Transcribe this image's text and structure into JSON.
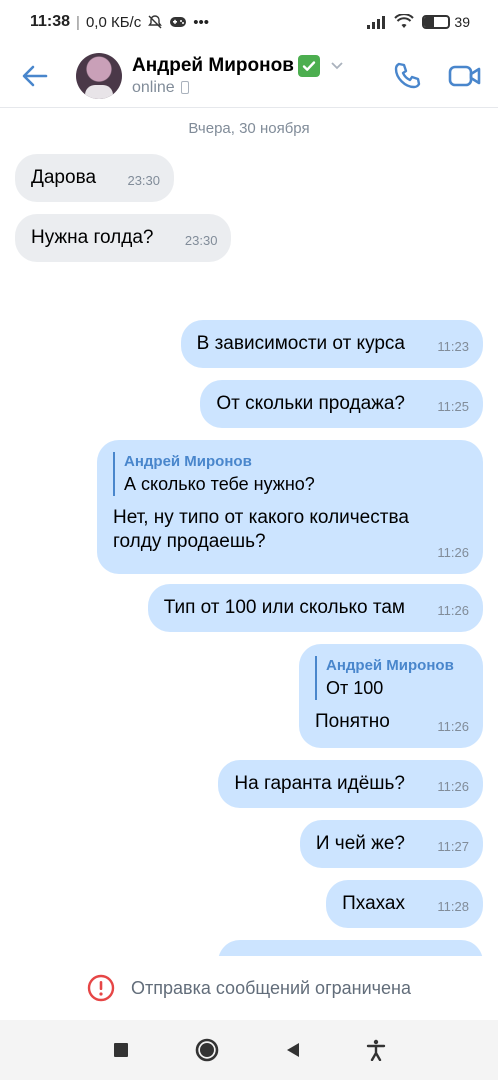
{
  "status_bar": {
    "time": "11:38",
    "network_speed": "0,0 КБ/с",
    "more": "•••",
    "battery_percent": "39",
    "battery_level": 0.39
  },
  "header": {
    "contact_name": "Андрей Миронов",
    "status": "online",
    "accent_color": "#4986cc"
  },
  "date_separator": "Вчера, 30 ноября",
  "messages": [
    {
      "direction": "in",
      "text": "Дарова",
      "time": "23:30"
    },
    {
      "direction": "in",
      "text": "Нужна голда?",
      "time": "23:30"
    },
    {
      "direction": "out",
      "text": "В зависимости от курса",
      "time": "11:23"
    },
    {
      "direction": "out",
      "text": "От скольки продажа?",
      "time": "11:25"
    },
    {
      "direction": "out",
      "reply_author": "Андрей Миронов",
      "reply_text": "А сколько тебе нужно?",
      "text": "Нет, ну типо от какого количества голду продаешь?",
      "time": "11:26"
    },
    {
      "direction": "out",
      "text": "Тип от 100 или сколько там",
      "time": "11:26"
    },
    {
      "direction": "out",
      "reply_author": "Андрей Миронов",
      "reply_text": "От 100",
      "text": "Понятно",
      "time": "11:26"
    },
    {
      "direction": "out",
      "text": "На гаранта идёшь?",
      "time": "11:26"
    },
    {
      "direction": "out",
      "text": "И чей же?",
      "time": "11:27"
    },
    {
      "direction": "out",
      "text": "Пхахах",
      "time": "11:28"
    }
  ],
  "restricted_notice": "Отправка сообщений ограничена",
  "icons": {
    "back": "arrow-left-icon",
    "call": "phone-icon",
    "video": "video-camera-icon",
    "warning": "exclamation-circle-icon",
    "nav_recents": "square-icon",
    "nav_home": "circle-icon",
    "nav_back": "triangle-icon",
    "nav_accessibility": "accessibility-icon"
  },
  "colors": {
    "incoming_bubble": "#ebedf0",
    "outgoing_bubble": "#cce4ff",
    "warning_red": "#e64646",
    "verified_green": "#4cae4f"
  }
}
